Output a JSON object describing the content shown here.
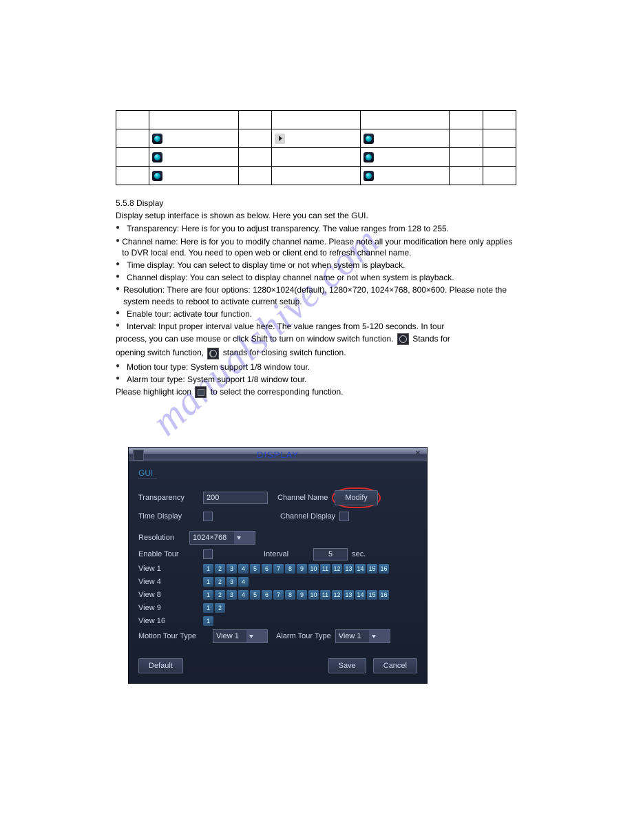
{
  "watermark": "manualshive.com",
  "body": {
    "section1": {
      "heading": "5.5.8 Display",
      "lines": [
        "Display setup interface is shown as below. Here you can set the GUI.",
        "Transparency: Here is for you to adjust transparency. The value ranges from 128 to 255.",
        "Channel name: Here is for you to modify channel name. Please note all your modification here only applies to DVR local end. You need to open web or client end to refresh channel name.",
        "Time display: You can select to display time or not when system is playback.",
        "Channel display: You can select to display channel name or not when system is playback.",
        "Resolution: There are four options: 1280×1024(default), 1280×720, 1024×768, 800×600. Please note the system needs to reboot to activate current setup.",
        "Enable tour: activate tour function.",
        "Interval: Input proper interval value here. The value ranges from 5-120 seconds. In tour",
        "Motion tour type: System support 1/8 window tour.",
        "Alarm tour type: System support 1/8 window tour."
      ],
      "inline_sentence": {
        "prefix": "process, you can use mouse or click Shift to turn on window switch function.",
        "icon1_after": " Stands for",
        "mid": "opening switch function,",
        "icon2_after": " stands for closing switch function."
      },
      "highlight_line_prefix": "Please highlight icon",
      "highlight_line_suffix": " to select the corresponding function."
    }
  },
  "dialog": {
    "title": "DISPLAY",
    "section": "GUI",
    "transparency_label": "Transparency",
    "transparency_value": "200",
    "channel_name_label": "Channel Name",
    "modify_label": "Modify",
    "time_display_label": "Time Display",
    "channel_display_label": "Channel Display",
    "resolution_label": "Resolution",
    "resolution_value": "1024×768",
    "enable_tour_label": "Enable Tour",
    "interval_label": "Interval",
    "interval_value": "5",
    "interval_unit": "sec.",
    "views": [
      {
        "label": "View 1",
        "count": 16
      },
      {
        "label": "View 4",
        "count": 4
      },
      {
        "label": "View 8",
        "count": 16
      },
      {
        "label": "View 9",
        "count": 2
      },
      {
        "label": "View 16",
        "count": 1
      }
    ],
    "motion_tour_label": "Motion Tour Type",
    "motion_tour_value": "View 1",
    "alarm_tour_label": "Alarm Tour Type",
    "alarm_tour_value": "View 1",
    "default_label": "Default",
    "save_label": "Save",
    "cancel_label": "Cancel"
  }
}
